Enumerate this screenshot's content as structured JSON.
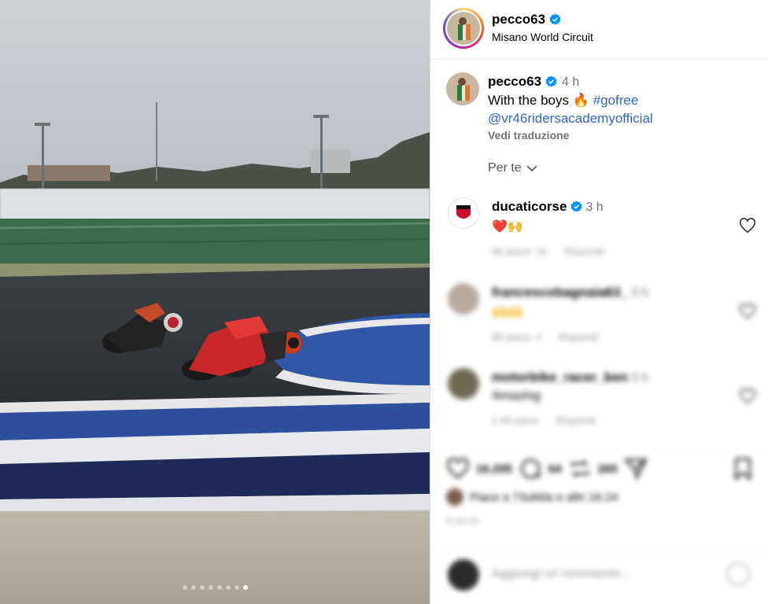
{
  "post": {
    "username": "pecco63",
    "location": "Misano World Circuit",
    "carousel_count": 8,
    "carousel_active_index": 7
  },
  "caption": {
    "username": "pecco63",
    "time": "4 h",
    "text": "With the boys 🔥",
    "hashtag": "#gofree",
    "mention": "@vr46ridersacademyofficial",
    "translate": "Vedi traduzione"
  },
  "sort": {
    "label": "Per te"
  },
  "comments": [
    {
      "username": "ducaticorse",
      "time": "3 h",
      "text": "❤️🙌",
      "likes": "Mi piace: 16",
      "reply": "Rispondi"
    },
    {
      "username": "francescobagnaia63_",
      "time": "3 h",
      "text": "🙌🙌",
      "likes": "Mi piace: 3",
      "reply": "Rispondi"
    },
    {
      "username": "motorbike_racer_ben",
      "time": "3 h",
      "text": "Amazing",
      "likes": "1 Mi piace",
      "reply": "Rispondi"
    }
  ],
  "actions": {
    "like_count": "16.205",
    "comment_count": "64",
    "repost_count": "265",
    "liked_by": "Piace a 73ukkla e altri 16.24",
    "ago": "4 ore fa"
  },
  "add_comment": {
    "placeholder": "Aggiungi un commento..."
  },
  "colors": {
    "accent": "#3066c6",
    "verified": "#0095f6",
    "heart_red": "#e02020"
  },
  "icons": [
    "verified-icon",
    "chevron-down-icon",
    "heart-icon",
    "comment-icon",
    "repost-icon",
    "share-icon",
    "bookmark-icon",
    "emoji-icon"
  ]
}
